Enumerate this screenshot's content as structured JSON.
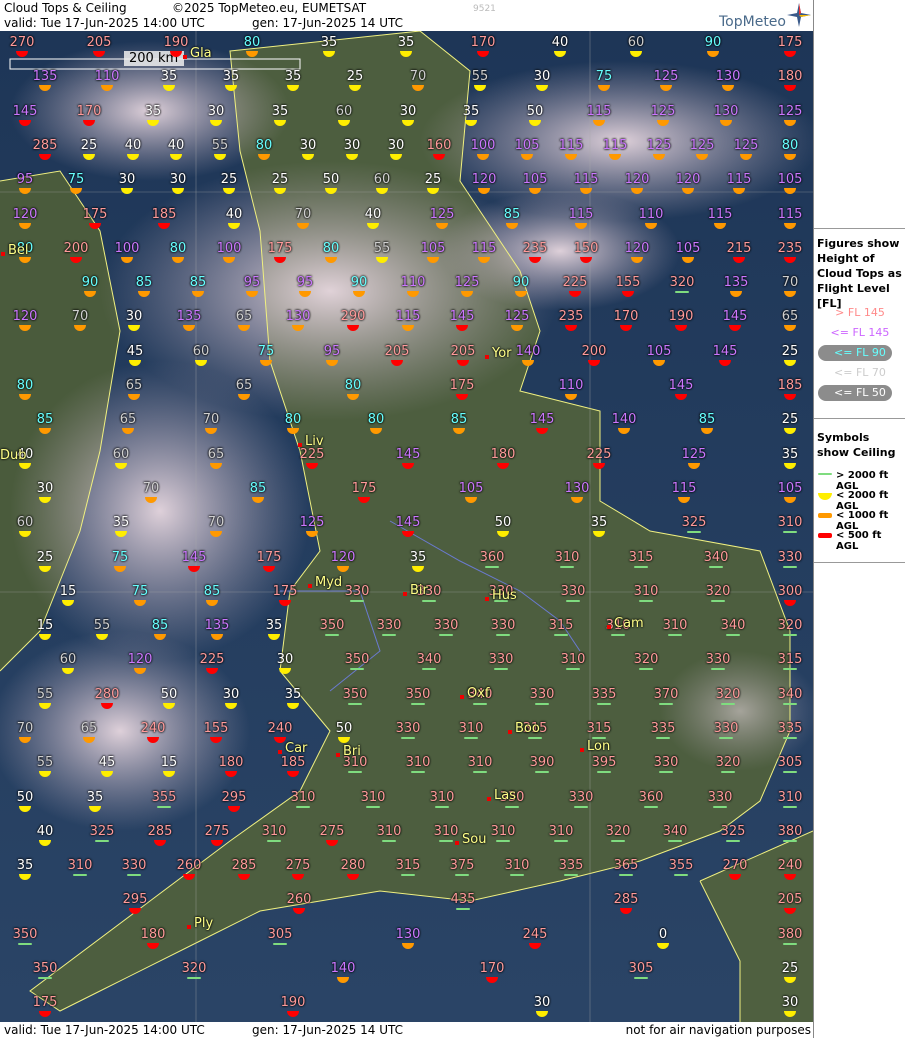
{
  "header": {
    "title": "Cloud Tops & Ceiling",
    "copyright": "©2025 TopMeteo.eu, EUMETSAT",
    "valid": "valid:  Tue  17-Jun-2025  14:00 UTC",
    "generated": "gen: 17-Jun-2025 14 UTC",
    "code": "9521",
    "logo": "TopMeteo"
  },
  "footer": {
    "valid": "valid:  Tue  17-Jun-2025  14:00 UTC",
    "generated": "gen: 17-Jun-2025 14 UTC",
    "note": "not for air navigation purposes"
  },
  "scale_bar": {
    "label": "200 km"
  },
  "legend": {
    "figures_title": "Figures show Height of Cloud Tops as Flight Level  [FL]",
    "levels": [
      {
        "label": "> FL 145",
        "color": "#ff8a8a",
        "pill": false
      },
      {
        "label": "<= FL 145",
        "color": "#cc66ff",
        "pill": false
      },
      {
        "label": "<= FL 90",
        "color": "#66ffff",
        "pill": true
      },
      {
        "label": "<= FL 70",
        "color": "#cccccc",
        "pill": false
      },
      {
        "label": "<= FL 50",
        "color": "#ffffff",
        "pill": true
      }
    ],
    "symbols_title": "Symbols show Ceiling",
    "ceilings": [
      {
        "label": "> 2000 ft AGL",
        "color": "#7fdc7f",
        "shape": "line"
      },
      {
        "label": "< 2000 ft AGL",
        "color": "#ffee00",
        "shape": "half"
      },
      {
        "label": "< 1000 ft AGL",
        "color": "#ff9900",
        "shape": "bar"
      },
      {
        "label": "< 500 ft AGL",
        "color": "#ff0000",
        "shape": "bar"
      }
    ]
  },
  "colors": {
    "high": "#ff9a9a",
    "mid": "#cc77ff",
    "fl90": "#66ffff",
    "fl70": "#d0d0d0",
    "fl50": "#ffffff"
  },
  "cities": [
    "Gla",
    "Bel",
    "Dub",
    "Liv",
    "Yor",
    "Myd",
    "Bir",
    "Hus",
    "Cam",
    "Oxf",
    "Boo",
    "Car",
    "Bri",
    "Lon",
    "Las",
    "Sou",
    "Ply"
  ],
  "cloud_tops": [
    "270",
    "205",
    "190",
    "80",
    "35",
    "35",
    "170",
    "40",
    "60",
    "90",
    "175",
    "135",
    "110",
    "35",
    "35",
    "35",
    "25",
    "70",
    "55",
    "30",
    "75",
    "125",
    "130",
    "180",
    "145",
    "170",
    "35",
    "30",
    "35",
    "60",
    "30",
    "35",
    "50",
    "115",
    "125",
    "130",
    "125",
    "285",
    "25",
    "40",
    "40",
    "55",
    "80",
    "30",
    "30",
    "30",
    "160",
    "100",
    "105",
    "115",
    "115",
    "125",
    "125",
    "125",
    "80",
    "95",
    "75",
    "30",
    "30",
    "25",
    "25",
    "50",
    "60",
    "25",
    "120",
    "105",
    "115",
    "120",
    "120",
    "115",
    "105",
    "120",
    "175",
    "185",
    "40",
    "70",
    "40",
    "125",
    "85",
    "115",
    "110",
    "115",
    "115",
    "80",
    "200",
    "100",
    "80",
    "100",
    "175",
    "80",
    "55",
    "105",
    "115",
    "235",
    "150",
    "120",
    "105",
    "215",
    "235",
    "90",
    "85",
    "85",
    "95",
    "95",
    "90",
    "110",
    "125",
    "90",
    "225",
    "155",
    "320",
    "135",
    "70",
    "120",
    "70",
    "30",
    "135",
    "65",
    "130",
    "290",
    "115",
    "145",
    "125",
    "235",
    "170",
    "190",
    "145",
    "65",
    "45",
    "60",
    "75",
    "95",
    "205",
    "205",
    "140",
    "200",
    "105",
    "145",
    "25",
    "80",
    "65",
    "65",
    "80",
    "175",
    "110",
    "145",
    "185",
    "85",
    "65",
    "70",
    "80",
    "80",
    "85",
    "145",
    "140",
    "85",
    "25",
    "40",
    "60",
    "65",
    "225",
    "145",
    "180",
    "225",
    "125",
    "35",
    "30",
    "70",
    "85",
    "175",
    "105",
    "130",
    "115",
    "105",
    "60",
    "35",
    "70",
    "125",
    "145",
    "50",
    "35",
    "325",
    "310",
    "25",
    "75",
    "145",
    "175",
    "120",
    "35",
    "360",
    "310",
    "315",
    "340",
    "330",
    "15",
    "75",
    "85",
    "175",
    "330",
    "330",
    "330",
    "330",
    "310",
    "320",
    "300",
    "15",
    "55",
    "85",
    "135",
    "35",
    "350",
    "330",
    "330",
    "330",
    "315",
    "310",
    "310",
    "340",
    "320",
    "60",
    "120",
    "225",
    "30",
    "350",
    "340",
    "330",
    "310",
    "320",
    "330",
    "315",
    "55",
    "280",
    "50",
    "30",
    "35",
    "350",
    "350",
    "340",
    "330",
    "335",
    "370",
    "320",
    "340",
    "70",
    "65",
    "240",
    "155",
    "240",
    "50",
    "330",
    "310",
    "315",
    "315",
    "335",
    "330",
    "335",
    "55",
    "45",
    "15",
    "180",
    "185",
    "310",
    "310",
    "310",
    "390",
    "395",
    "330",
    "320",
    "305",
    "50",
    "35",
    "355",
    "295",
    "310",
    "310",
    "310",
    "330",
    "330",
    "360",
    "330",
    "310",
    "40",
    "325",
    "285",
    "275",
    "310",
    "275",
    "310",
    "310",
    "310",
    "310",
    "320",
    "340",
    "325",
    "380",
    "35",
    "310",
    "330",
    "260",
    "285",
    "275",
    "280",
    "315",
    "375",
    "310",
    "335",
    "365",
    "355",
    "270",
    "240",
    "295",
    "260",
    "435",
    "285",
    "205",
    "350",
    "180",
    "305",
    "130",
    "245",
    "0",
    "380",
    "350",
    "320",
    "140",
    "170",
    "305",
    "25",
    "175",
    "190",
    "30",
    "30"
  ]
}
